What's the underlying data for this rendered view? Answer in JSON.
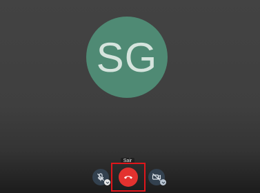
{
  "participant": {
    "initials": "SG",
    "avatar_color": "#4f8a74"
  },
  "controls": {
    "hangup_tooltip": "Sair",
    "mic_icon": "microphone-muted-icon",
    "hangup_icon": "phone-hangup-icon",
    "camera_icon": "camera-off-icon",
    "hangup_color": "#e3322f",
    "button_color": "#33414f",
    "highlight_color": "#e1161b"
  }
}
